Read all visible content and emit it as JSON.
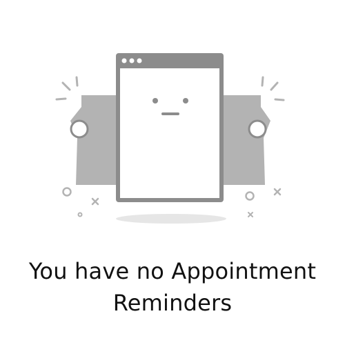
{
  "empty_state": {
    "message_line1": "You have no Appointment",
    "message_line2": "Reminders",
    "illustration_icon": "empty-window-with-face-illustration",
    "colors": {
      "illustration_dark": "#8c8c8c",
      "illustration_light": "#b3b3b3",
      "shadow": "#e6e6e6",
      "text": "#111111",
      "background": "#ffffff"
    }
  }
}
